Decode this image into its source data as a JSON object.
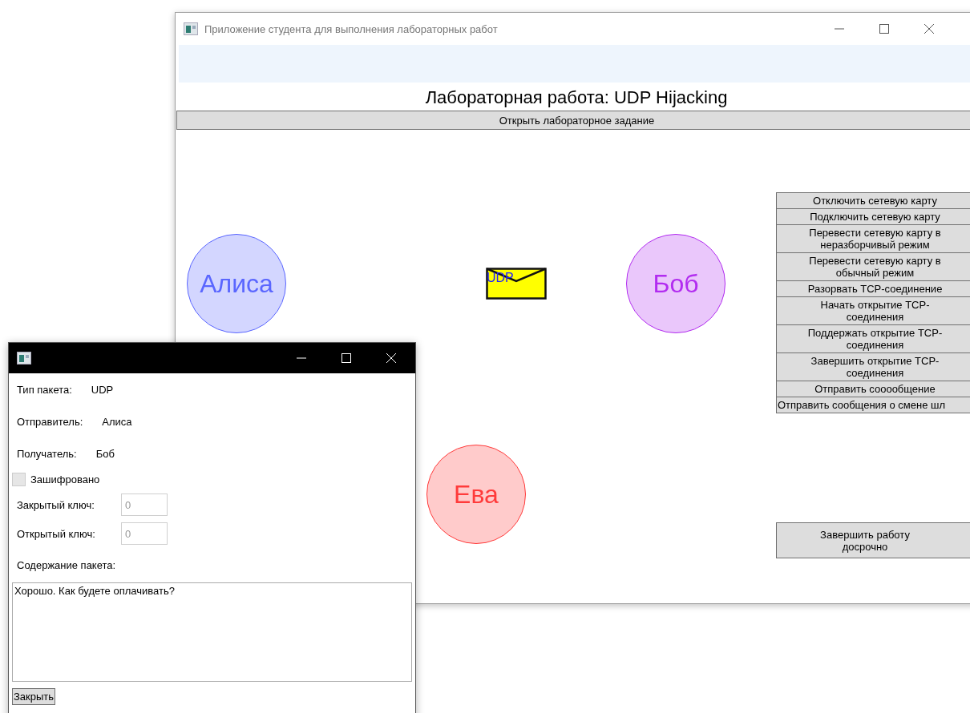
{
  "main_window": {
    "title": "Приложение студента для выполнения лабораторных работ",
    "heading": "Лабораторная работа: UDP Hijacking",
    "open_task_button": "Открыть лабораторное задание",
    "nodes": [
      {
        "name": "Алиса",
        "color": "#5a66ff"
      },
      {
        "name": "Боб",
        "color": "#b22cf0"
      },
      {
        "name": "Ева",
        "color": "#ff3b3b"
      }
    ],
    "packet": {
      "label": "UDP"
    },
    "actions": [
      "Отключить сетевую карту",
      "Подключить сетевую карту",
      "Перевести сетевую карту в неразборчивый режим",
      "Перевести сетевую карту в обычный режим",
      "Разорвать TCP-соединение",
      "Начать открытие TCP-соединения",
      "Поддержать открытие TCP-соединения",
      "Завершить открытие TCP-соединения",
      "Отправить сооообщение",
      "Отправить сообщения о смене шл"
    ],
    "finish_button": "Завершить работу досрочно"
  },
  "packet_dialog": {
    "fields": [
      {
        "label": "Тип пакета:",
        "value": "UDP"
      },
      {
        "label": "Отправитель:",
        "value": "Алиса"
      },
      {
        "label": "Получатель:",
        "value": "Боб"
      }
    ],
    "encrypted": {
      "label": "Зашифровано",
      "checked": false
    },
    "keys": [
      {
        "label": "Закрытый ключ:",
        "value": "0",
        "disabled": true
      },
      {
        "label": "Открытый ключ:",
        "value": "0",
        "disabled": true
      }
    ],
    "content_label": "Содержание пакета:",
    "content": "Хорошо. Как будете оплачивать?",
    "close_button": "Закрыть"
  }
}
